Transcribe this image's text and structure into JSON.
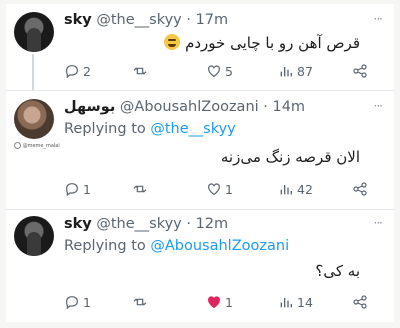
{
  "tweets": [
    {
      "name": "sky",
      "handle": "@the__skyy",
      "separator": "·",
      "time": "17m",
      "more": "···",
      "text": "قرص آهن رو با چایی خوردم",
      "emoji": "grimacing-face-emoji",
      "actions": {
        "replies": "2",
        "retweets": "",
        "likes": "5",
        "views": "87"
      }
    },
    {
      "name": "بوسهل",
      "handle": "@AbousahlZoozani",
      "separator": "·",
      "time": "14m",
      "more": "···",
      "replying_prefix": "Replying to",
      "replying_to": "@the__skyy",
      "text": "الان قرصه زنگ می‌زنه",
      "watermark": "@meme_malai",
      "actions": {
        "replies": "1",
        "retweets": "",
        "likes": "1",
        "views": "42"
      }
    },
    {
      "name": "sky",
      "handle": "@the__skyy",
      "separator": "·",
      "time": "12m",
      "more": "···",
      "replying_prefix": "Replying to",
      "replying_to": "@AbousahlZoozani",
      "text": "به کی؟",
      "actions": {
        "replies": "1",
        "retweets": "",
        "likes": "1",
        "views": "14",
        "liked": true
      }
    }
  ],
  "colors": {
    "link": "#1d9bf0",
    "liked_heart": "#e0245e",
    "muted": "#5a6570"
  }
}
